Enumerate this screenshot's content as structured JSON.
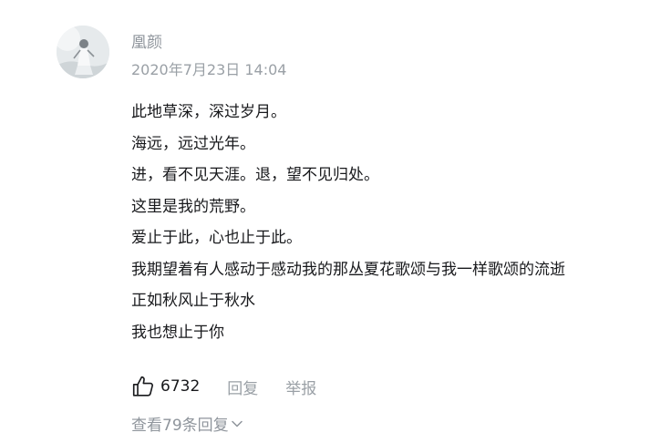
{
  "comment": {
    "username": "凰颜",
    "timestamp": "2020年7月23日 14:04",
    "avatar_icon": "user-avatar",
    "lines": [
      "此地草深，深过岁月。",
      "海远，远过光年。",
      "进，看不见天涯。退，望不见归处。",
      "这里是我的荒野。",
      "爱止于此，心也止于此。",
      "我期望着有人感动于感动我的那丛夏花歌颂与我一样歌颂的流逝",
      "正如秋风止于秋水",
      "我也想止于你"
    ],
    "actions": {
      "like_icon": "thumbs-up-icon",
      "like_count": "6732",
      "reply_label": "回复",
      "report_label": "举报"
    },
    "view_replies_label": "查看79条回复",
    "view_replies_icon": "chevron-down-icon"
  }
}
